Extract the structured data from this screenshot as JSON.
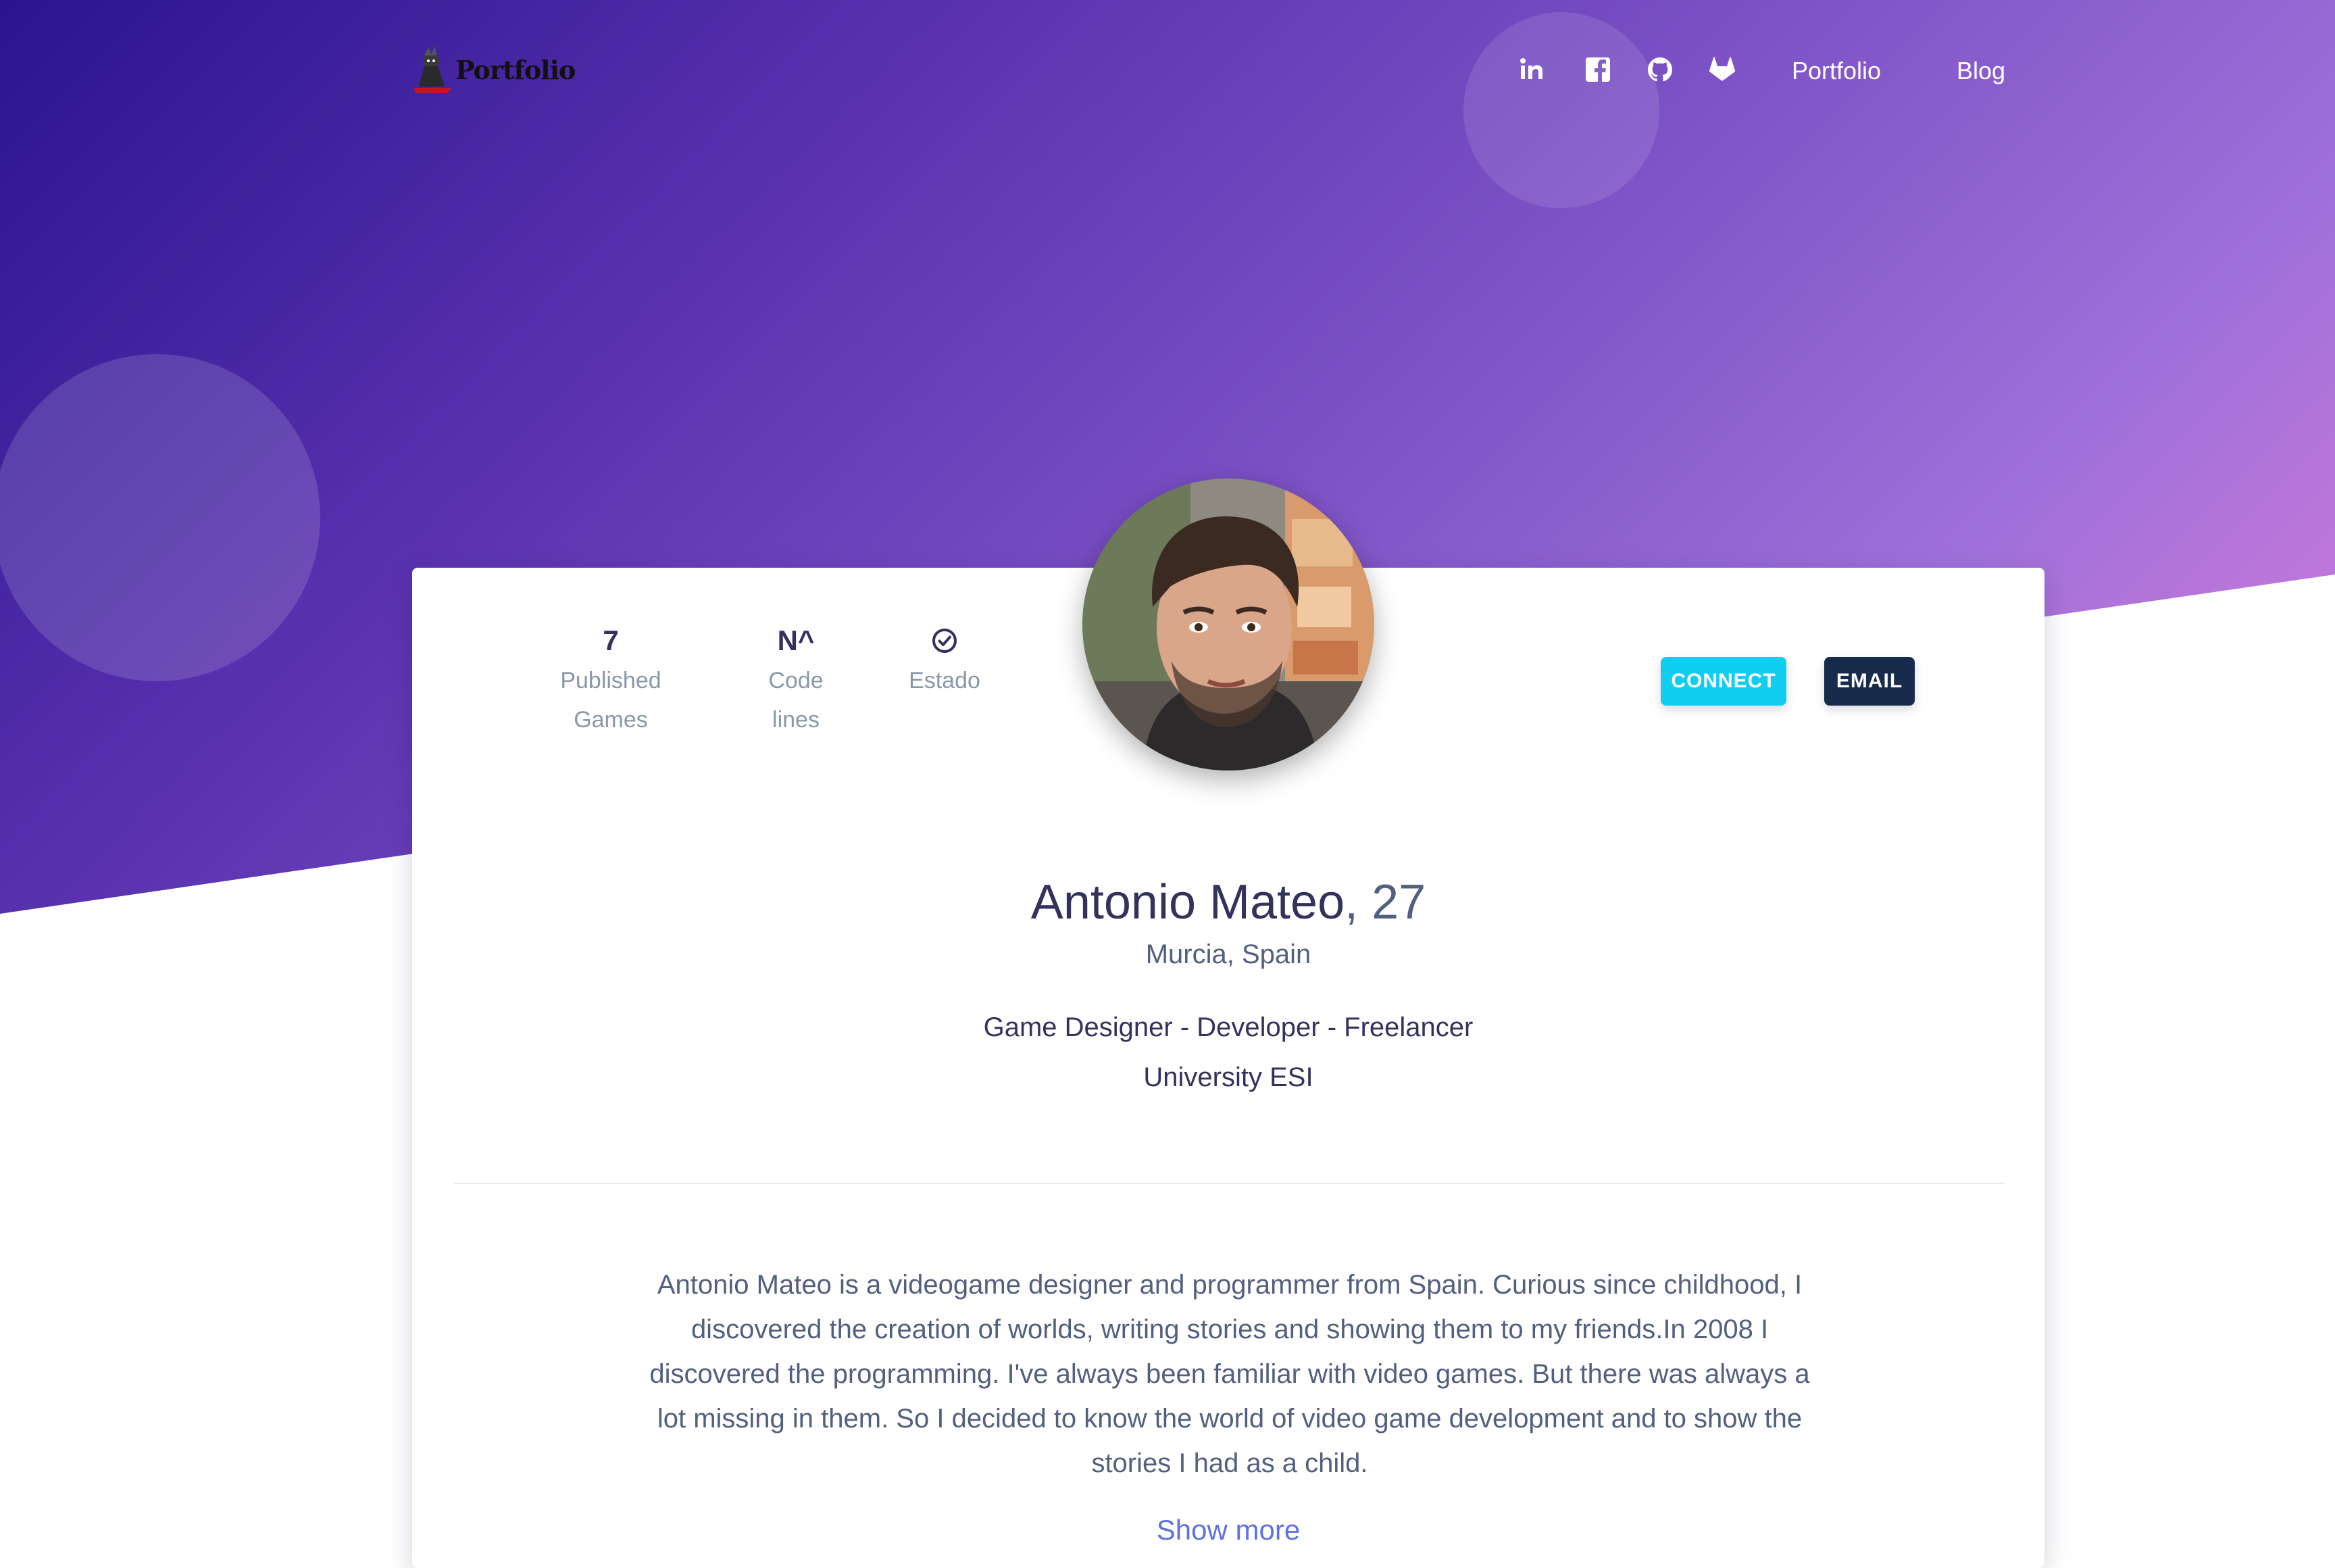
{
  "navbar": {
    "brand_text": "Portfolio",
    "icons": [
      "linkedin-icon",
      "facebook-icon",
      "github-icon",
      "gitlab-icon"
    ],
    "links": [
      "Portfolio",
      "Blog"
    ]
  },
  "profile": {
    "stats": [
      {
        "value": "7",
        "label": "Published\nGames"
      },
      {
        "value": "N^",
        "label": "Code\nlines"
      },
      {
        "value": "",
        "label": "Estado",
        "icon": "check-circle-icon"
      }
    ],
    "buttons": {
      "connect": "CONNECT",
      "email": "EMAIL"
    },
    "name": "Antonio Mateo",
    "age": ", 27",
    "location": "Murcia, Spain",
    "roles": "Game Designer - Developer - Freelancer",
    "university": "University ESI",
    "bio": "Antonio Mateo is a videogame designer and programmer from Spain. Curious since childhood, I discovered the creation of worlds, writing stories and showing them to my friends.In 2008 I discovered the programming. I've always been familiar with video games. But there was always a lot missing in them. So I decided to know the world of video game development and to show the stories I had as a child.",
    "show_more": "Show more"
  },
  "colors": {
    "hero_start": "#2a148e",
    "hero_end": "#dd7bd9",
    "connect_button": "#11cdef",
    "email_button": "#172b4d",
    "heading": "#32325d",
    "link": "#5e72e4"
  }
}
